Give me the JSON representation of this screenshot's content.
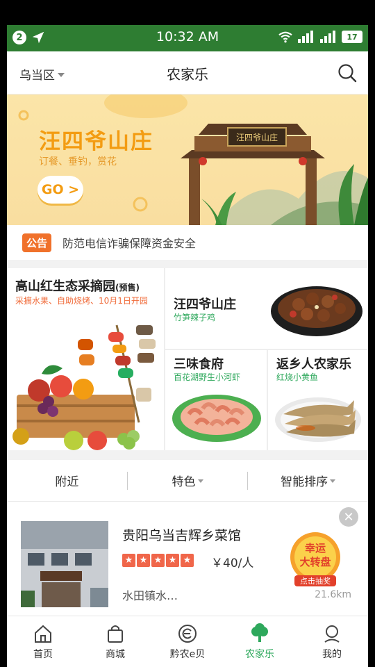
{
  "status_bar": {
    "notification_count": "2",
    "time": "10:32 AM",
    "battery": "17"
  },
  "header": {
    "location": "乌当区",
    "title": "农家乐"
  },
  "banner": {
    "title": "汪四爷山庄",
    "subtitle": "订餐、垂钓，赏花",
    "go_label": "GO >",
    "sign_text": "汪四爷山庄"
  },
  "notice": {
    "tag": "公告",
    "text": "防范电信诈骗保障资金安全"
  },
  "features": [
    {
      "title": "高山红生态采摘园",
      "badge": "(预售)",
      "subtitle": "采摘水果、自助烧烤、10月1日开园"
    },
    {
      "title": "汪四爷山庄",
      "subtitle": "竹笋辣子鸡"
    },
    {
      "title": "三味食府",
      "subtitle": "百花湖野生小河虾"
    },
    {
      "title": "返乡人农家乐",
      "subtitle": "红烧小黄鱼"
    }
  ],
  "filters": [
    {
      "label": "附近"
    },
    {
      "label": "特色"
    },
    {
      "label": "智能排序"
    }
  ],
  "listing": {
    "name": "贵阳乌当吉辉乡菜馆",
    "rating": 5,
    "price": "￥40/人",
    "address": "水田镇水…",
    "distance": "21.6km",
    "promo_line1": "幸运",
    "promo_line2": "大转盘",
    "promo_cta": "点击抽奖"
  },
  "tabs": [
    {
      "label": "首页",
      "icon": "home-icon"
    },
    {
      "label": "商城",
      "icon": "shopping-bag-icon"
    },
    {
      "label": "黔农e贝",
      "icon": "e-coin-icon"
    },
    {
      "label": "农家乐",
      "icon": "tree-icon",
      "active": true
    },
    {
      "label": "我的",
      "icon": "user-icon"
    }
  ],
  "colors": {
    "primary_green": "#2e7d32",
    "accent_green": "#2ea85c",
    "banner_orange": "#f39c12",
    "notice_orange": "#f0712b"
  }
}
